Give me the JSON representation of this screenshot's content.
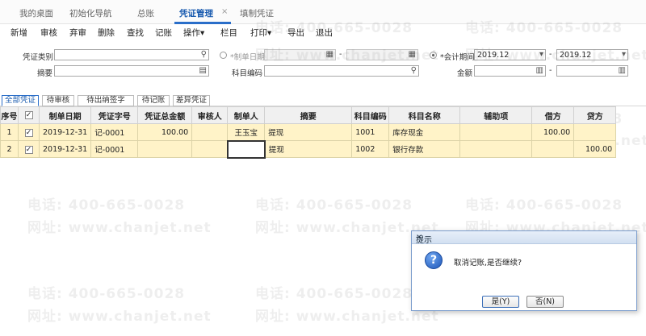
{
  "tabs": [
    {
      "label": "我的桌面"
    },
    {
      "label": "初始化导航"
    },
    {
      "label": "总账"
    },
    {
      "label": "凭证管理",
      "active": true
    },
    {
      "label": "填制凭证"
    }
  ],
  "tab_close_glyph": "×",
  "toolbar": [
    "新增",
    "审核",
    "弃审",
    "删除",
    "查找",
    "记账",
    "操作▾",
    "栏目",
    "打印▾",
    "导出",
    "退出"
  ],
  "filters": {
    "voucher_type_label": "凭证类别",
    "voucher_type_value": "",
    "summary_label": "摘要",
    "summary_value": "",
    "make_date_label": "*制单日期",
    "make_date_from": "",
    "make_date_to": "",
    "account_code_label": "科目编码",
    "account_code_value": "",
    "period_label": "*会计期间",
    "period_from": "2019.12",
    "period_to": "2019.12",
    "amount_label": "金额",
    "amount_from": "",
    "amount_to": "",
    "dash": "-"
  },
  "subtabs": [
    "全部凭证",
    "待审核",
    "待出纳签字",
    "待记账",
    "差异凭证"
  ],
  "table": {
    "columns": [
      "序号",
      "",
      "制单日期",
      "凭证字号",
      "凭证总金额",
      "审核人",
      "制单人",
      "摘要",
      "科目编码",
      "科目名称",
      "辅助项",
      "借方",
      "贷方"
    ],
    "rows": [
      {
        "seq": "1",
        "checked": "✓",
        "date": "2019-12-31",
        "voucher_no": "记-0001",
        "total": "100.00",
        "auditor": "",
        "maker": "王玉宝",
        "summary": "提现",
        "code": "1001",
        "name": "库存现金",
        "aux": "",
        "debit": "100.00",
        "credit": ""
      },
      {
        "seq": "2",
        "checked": "✓",
        "date": "2019-12-31",
        "voucher_no": "记-0001",
        "total": "",
        "auditor": "",
        "maker": "",
        "summary": "提现",
        "code": "1002",
        "name": "银行存款",
        "aux": "",
        "debit": "",
        "credit": "100.00"
      }
    ]
  },
  "watermark": {
    "phone": "电话: 400-665-0028",
    "site": "网址: www.chanjet.net"
  },
  "dialog": {
    "title": "提示",
    "close": "×",
    "message": "取消记账,是否继续?",
    "yes": "是(Y)",
    "no": "否(N)",
    "icon_glyph": "?"
  },
  "icons": {
    "search": "⚲",
    "calendar": "▦",
    "dropdown": "▾",
    "lookup": "▤",
    "calculator": "▥"
  }
}
